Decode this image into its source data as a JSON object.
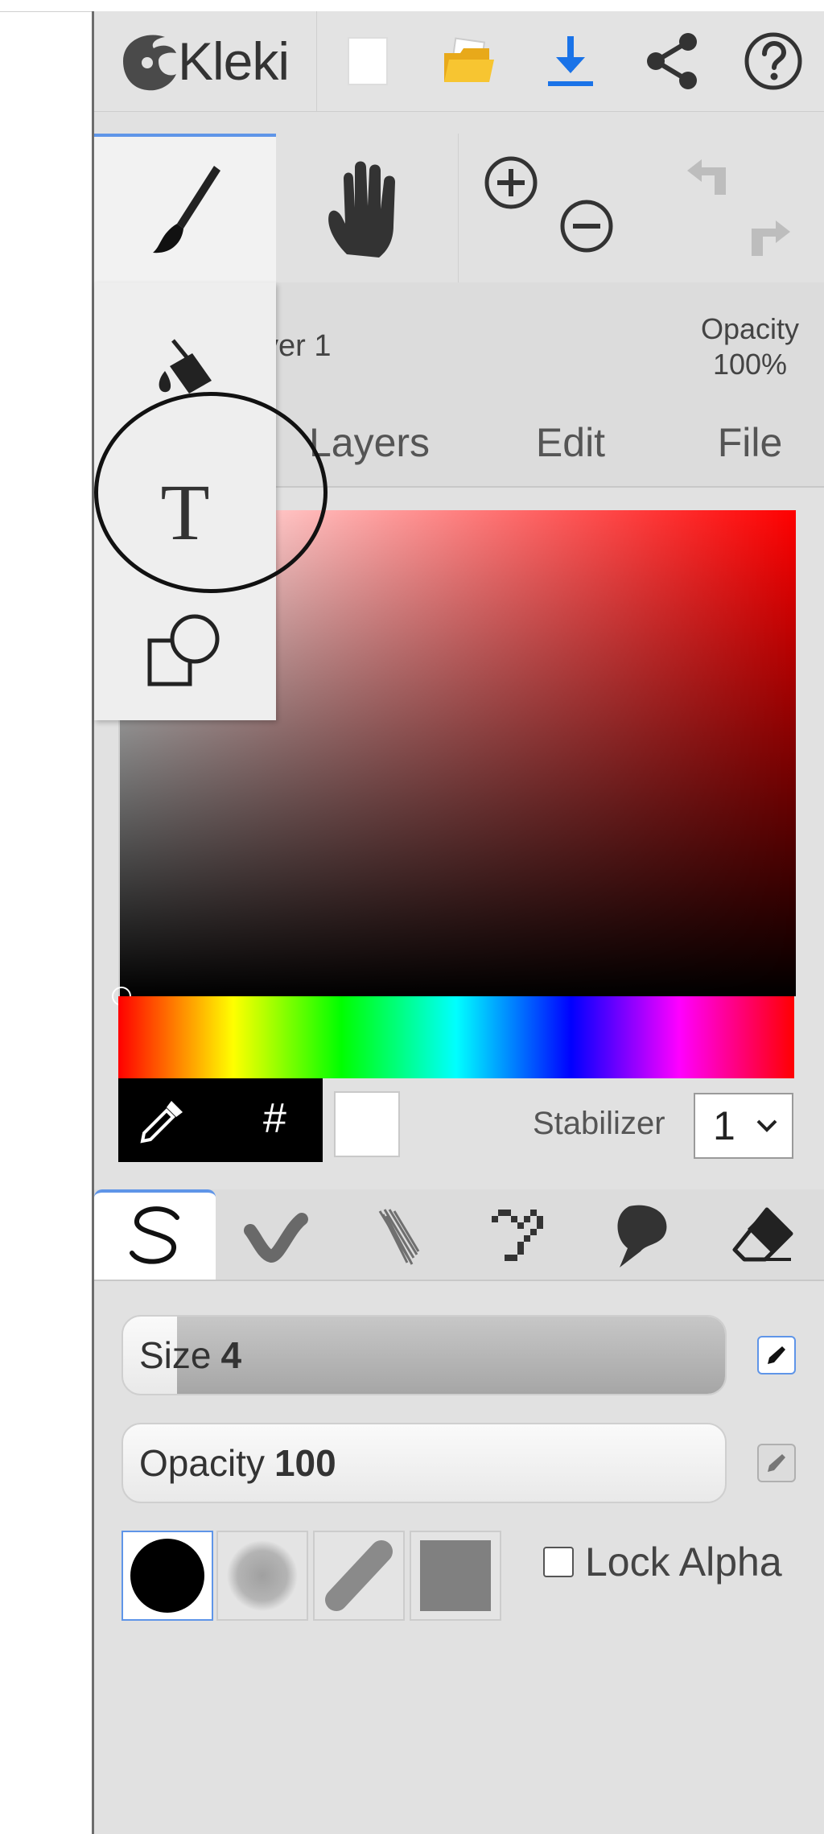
{
  "app": {
    "name": "Kleki"
  },
  "topbar": {
    "buttons": [
      {
        "name": "new-image-button",
        "icon": "blank-page-icon"
      },
      {
        "name": "open-file-button",
        "icon": "folder-icon"
      },
      {
        "name": "save-button",
        "icon": "download-icon"
      },
      {
        "name": "share-button",
        "icon": "share-icon"
      },
      {
        "name": "help-button",
        "icon": "question-mark-icon"
      }
    ]
  },
  "tools": {
    "brush": {
      "icon": "paintbrush-icon",
      "active": true
    },
    "hand": {
      "icon": "hand-icon"
    },
    "zoom": {
      "icons": [
        "zoom-in-icon",
        "zoom-out-icon"
      ]
    },
    "history": {
      "icons": [
        "undo-icon",
        "redo-icon"
      ]
    }
  },
  "layer": {
    "name_visible": "yer 1",
    "opacity_label": "Opacity",
    "opacity_value": "100%"
  },
  "tabs": [
    "Layers",
    "Edit",
    "File"
  ],
  "tool_dropdown": {
    "items": [
      {
        "name": "fill-tool",
        "icon": "paint-bucket-icon"
      },
      {
        "name": "text-tool",
        "icon": "text-icon",
        "label": "T",
        "highlighted": true
      },
      {
        "name": "shape-tool",
        "icon": "shapes-icon"
      }
    ]
  },
  "color": {
    "hue_hex": "#ff0000",
    "current_hex": "#ffffff",
    "hex_label": "#",
    "picker_icon": "eyedropper-icon"
  },
  "stabilizer": {
    "label": "Stabilizer",
    "value": "1"
  },
  "brush_types": [
    {
      "name": "pen-brush",
      "icon": "pen-stroke-icon",
      "active": true
    },
    {
      "name": "blend-brush",
      "icon": "blend-stroke-icon"
    },
    {
      "name": "sketchy-brush",
      "icon": "sketchy-stroke-icon"
    },
    {
      "name": "pixel-brush",
      "icon": "pixel-stroke-icon"
    },
    {
      "name": "chemy-brush",
      "icon": "chemy-icon"
    },
    {
      "name": "eraser-brush",
      "icon": "eraser-icon"
    }
  ],
  "brush_settings": {
    "size_label": "Size",
    "size_value": "4",
    "size_fill_fraction": 0.09,
    "opacity_label": "Opacity",
    "opacity_value": "100",
    "opacity_fill_fraction": 0.0,
    "lock_alpha_label": "Lock Alpha",
    "lock_alpha_checked": false,
    "shapes": [
      {
        "name": "round-shape",
        "icon": "circle-icon",
        "active": true
      },
      {
        "name": "soft-shape",
        "icon": "soft-circle-icon"
      },
      {
        "name": "chalk-shape",
        "icon": "capsule-icon"
      },
      {
        "name": "square-shape",
        "icon": "square-icon"
      }
    ]
  }
}
